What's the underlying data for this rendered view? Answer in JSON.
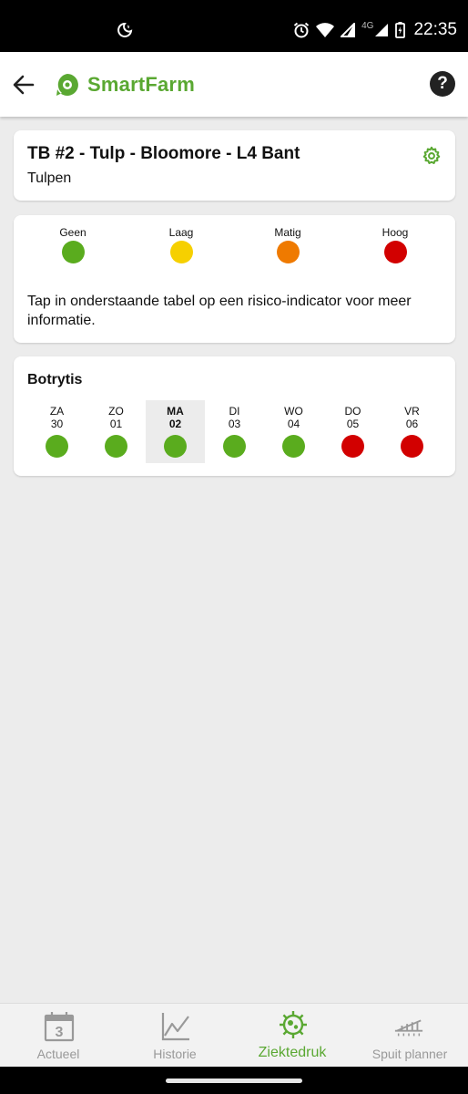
{
  "status_bar": {
    "time": "22:35",
    "network": "4G"
  },
  "app_bar": {
    "brand": "SmartFarm"
  },
  "field_card": {
    "title": "TB #2 - Tulp - Bloomore - L4 Bant",
    "crop": "Tulpen"
  },
  "legend": {
    "items": [
      {
        "label": "Geen",
        "color": "#5aac1e"
      },
      {
        "label": "Laag",
        "color": "#f6d000"
      },
      {
        "label": "Matig",
        "color": "#ef7a00"
      },
      {
        "label": "Hoog",
        "color": "#d20000"
      }
    ],
    "info": "Tap in onderstaande tabel op een risico-indicator voor meer informatie."
  },
  "disease": {
    "name": "Botrytis",
    "days": [
      {
        "name": "ZA",
        "date": "30",
        "risk": "Geen"
      },
      {
        "name": "ZO",
        "date": "01",
        "risk": "Geen"
      },
      {
        "name": "MA",
        "date": "02",
        "risk": "Geen",
        "selected": true
      },
      {
        "name": "DI",
        "date": "03",
        "risk": "Geen"
      },
      {
        "name": "WO",
        "date": "04",
        "risk": "Geen"
      },
      {
        "name": "DO",
        "date": "05",
        "risk": "Hoog"
      },
      {
        "name": "VR",
        "date": "06",
        "risk": "Hoog"
      }
    ]
  },
  "bottom_nav": {
    "items": [
      {
        "label": "Actueel",
        "icon": "calendar-icon",
        "badge": "3"
      },
      {
        "label": "Historie",
        "icon": "chart-line-icon"
      },
      {
        "label": "Ziektedruk",
        "icon": "virus-icon",
        "active": true
      },
      {
        "label": "Spuit planner",
        "icon": "sprayer-icon"
      }
    ]
  },
  "colors": {
    "brand_green": "#5aa832"
  }
}
